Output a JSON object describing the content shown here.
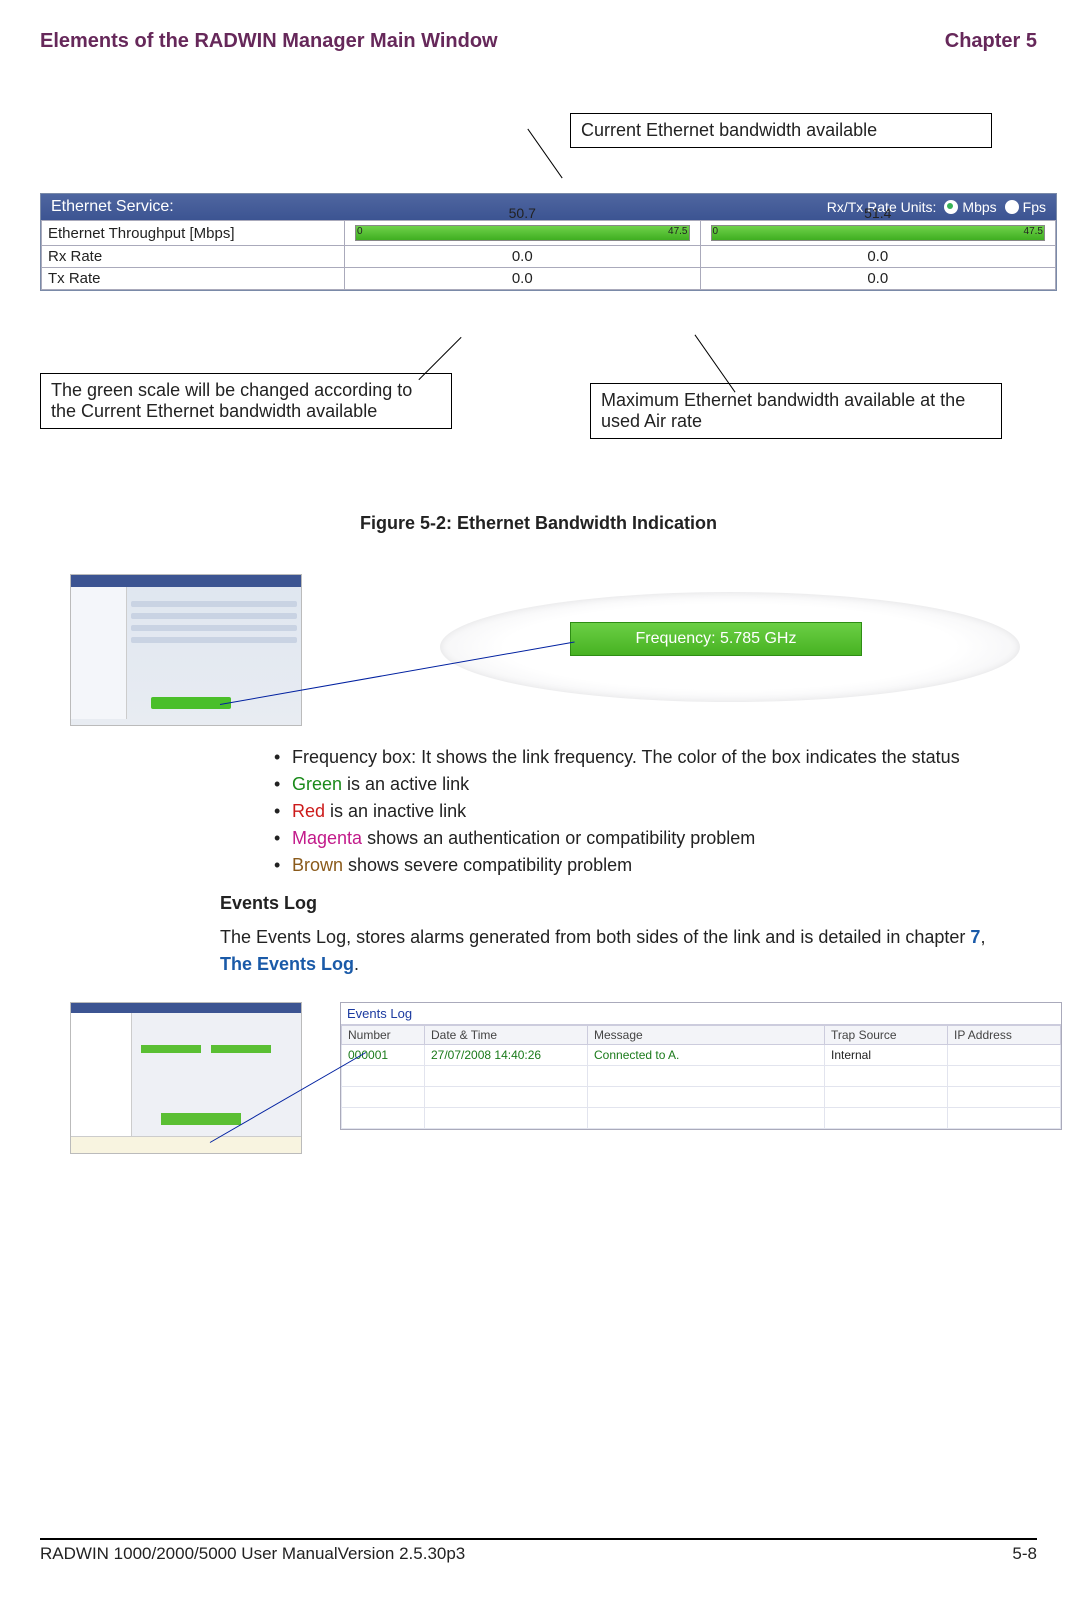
{
  "header": {
    "left": "Elements of the RADWIN Manager Main Window",
    "right": "Chapter 5"
  },
  "fig1": {
    "callouts": {
      "top": "Current Ethernet bandwidth available",
      "bottom_left": "The green scale will be changed according to the Current Ethernet bandwidth available",
      "bottom_right": "Maximum Ethernet bandwidth available at the used Air rate"
    },
    "panel_title_left": "Ethernet Service:",
    "panel_title_right_label": "Rx/Tx Rate Units:",
    "radio_mbps": "Mbps",
    "radio_fps": "Fps",
    "rows": {
      "throughput_label": "Ethernet Throughput [Mbps]",
      "rx_label": "Rx Rate",
      "tx_label": "Tx Rate"
    },
    "cols": {
      "a_value": "50.7",
      "b_value": "51.4",
      "bar_min": "0",
      "bar_max_a": "47.5",
      "bar_max_b": "47.5",
      "rx_a": "0.0",
      "rx_b": "0.0",
      "tx_a": "0.0",
      "tx_b": "0.0"
    },
    "caption": "Figure 5-2: Ethernet Bandwidth Indication"
  },
  "freq": {
    "label": "Frequency: 5.785 GHz"
  },
  "bullets": {
    "intro": "Frequency box: It shows the link frequency. The color of the box indicates the status",
    "green_word": "Green",
    "green_rest": " is an active link",
    "red_word": "Red",
    "red_rest": " is an inactive link",
    "magenta_word": "Magenta",
    "magenta_rest": " shows an authentication or compatibility problem",
    "brown_word": "Brown",
    "brown_rest": " shows severe compatibility problem"
  },
  "events": {
    "heading": "Events Log",
    "para_pre": "The Events Log, stores alarms generated from both sides of the link and is detailed in chapter ",
    "chap_num": "7",
    "comma": ", ",
    "link_text": "The Events Log",
    "period": ".",
    "panel_title": "Events Log",
    "cols": [
      "Number",
      "Date & Time",
      "Message",
      "Trap Source",
      "IP Address"
    ],
    "row": {
      "num": "000001",
      "dt": "27/07/2008 14:40:26",
      "msg": "Connected to A.",
      "src": "Internal",
      "ip": ""
    }
  },
  "footer": {
    "left": "RADWIN 1000/2000/5000 User ManualVersion  2.5.30p3",
    "right": "5-8"
  }
}
